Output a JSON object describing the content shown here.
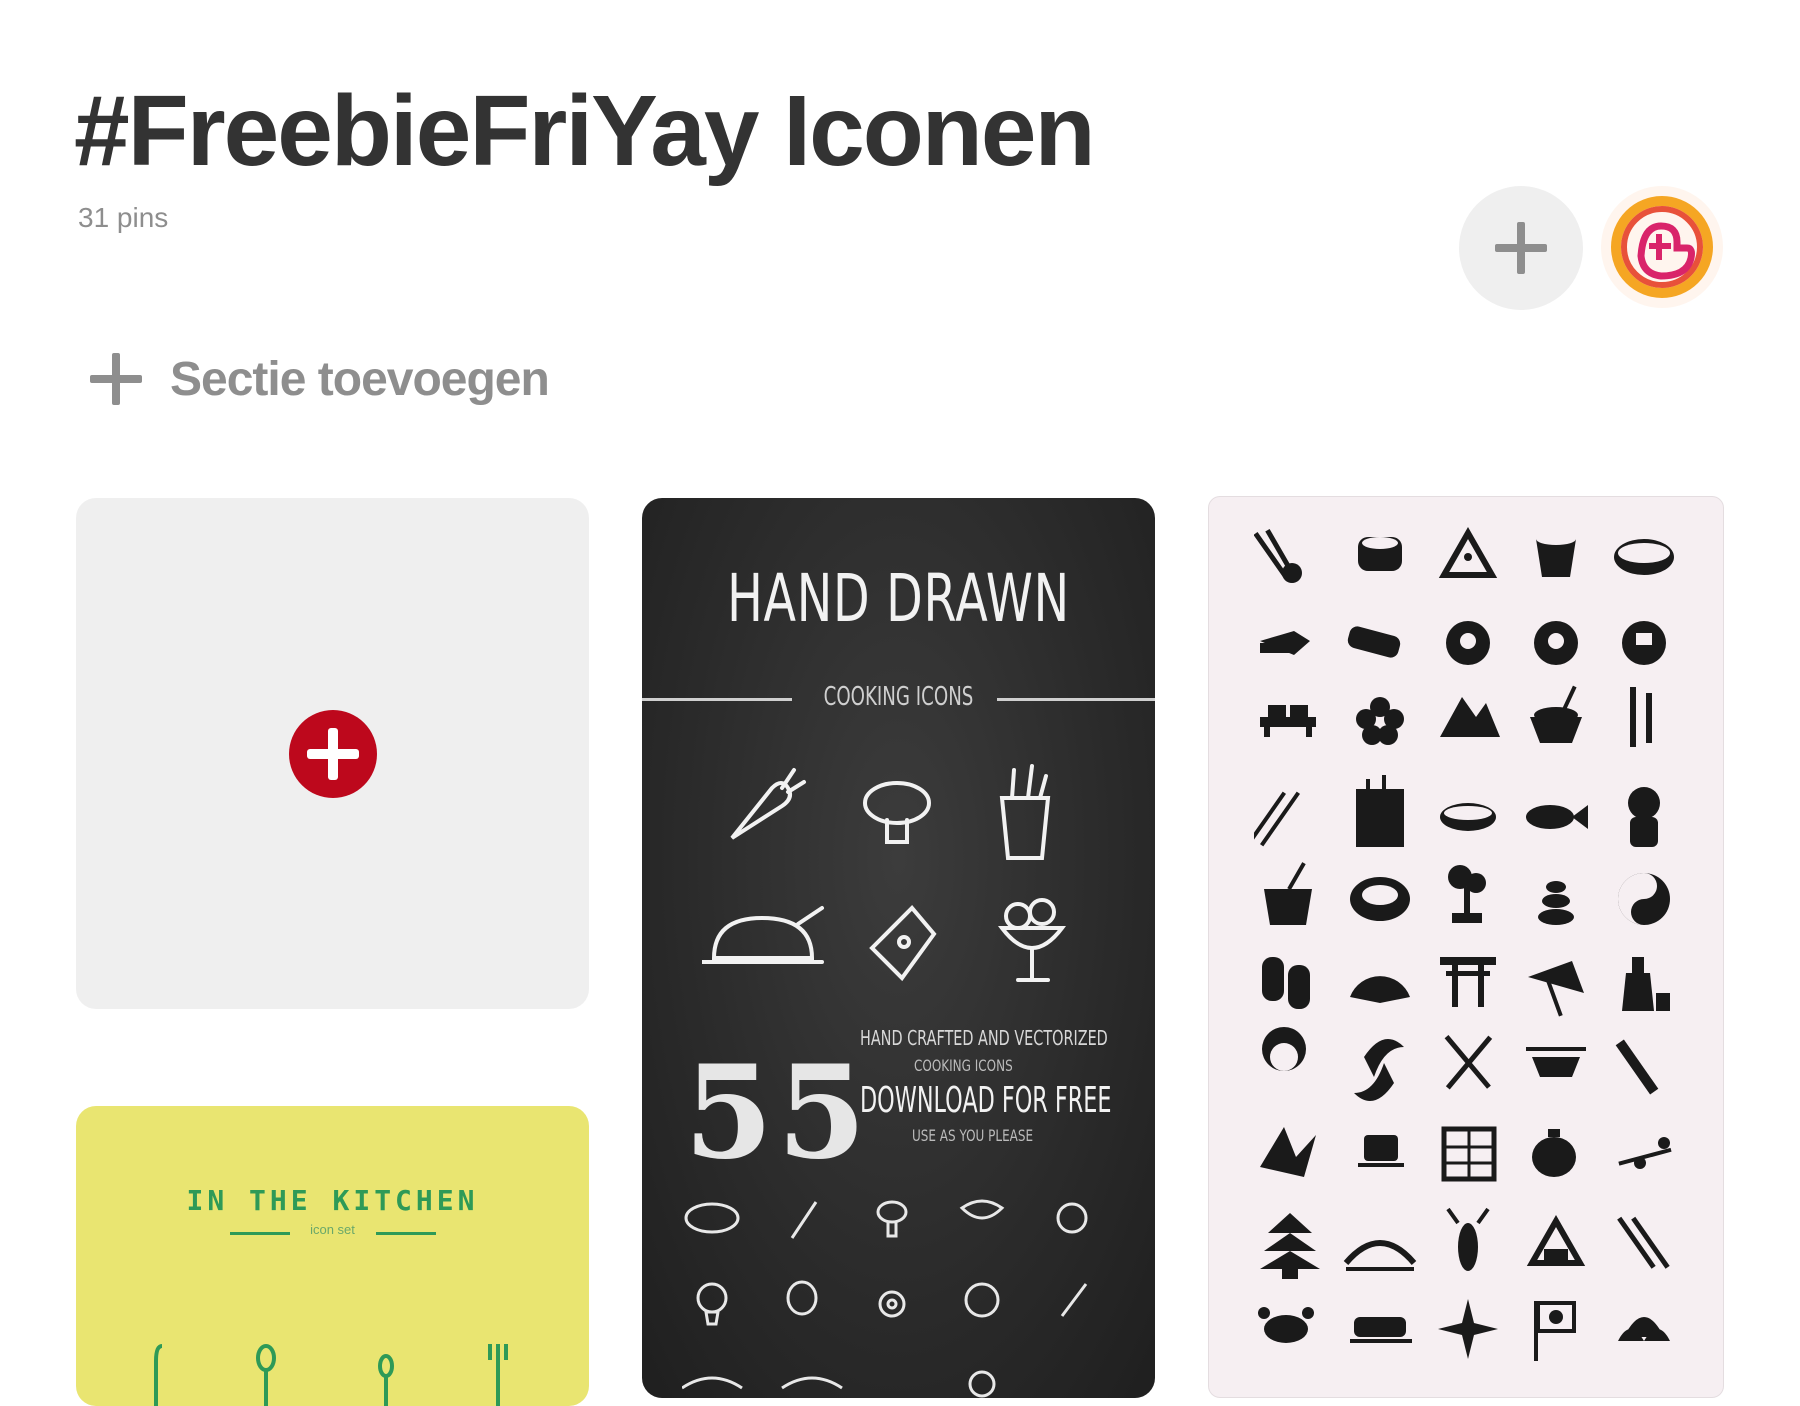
{
  "board": {
    "title": "#FreebieFriYay Iconen",
    "pin_count": "31 pins"
  },
  "toolbar": {
    "add_button_icon": "plus-icon",
    "avatar_icon": "profile-logo-icon"
  },
  "section": {
    "add_label": "Sectie toevoegen"
  },
  "pins": {
    "create": {
      "icon": "red-plus-icon"
    },
    "yellow": {
      "title": "IN THE KITCHEN",
      "subtitle": "icon set"
    },
    "black": {
      "title": "HAND DRAWN",
      "subtitle": "COOKING ICONS",
      "count": "55",
      "line1": "HAND CRAFTED AND VECTORIZED",
      "line2": "COOKING ICONS",
      "line3": "DOWNLOAD FOR FREE",
      "line4": "USE AS YOU PLEASE"
    },
    "pink": {
      "icon_set": "japanese-food-icon-grid"
    }
  },
  "colors": {
    "title": "#333333",
    "muted": "#8e8e8e",
    "pinterest_red": "#bd081c",
    "yellow_card": "#e9e571",
    "green_text": "#2e9a57"
  }
}
